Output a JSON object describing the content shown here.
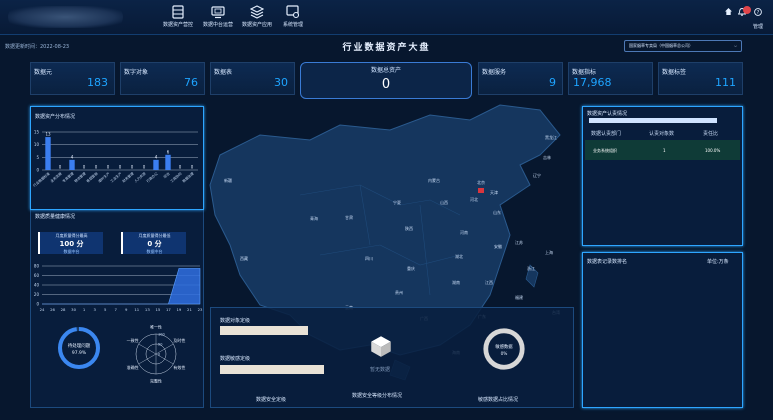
{
  "nav": {
    "items": [
      {
        "label": "数据资产营控",
        "icon": "database-icon"
      },
      {
        "label": "数据中台运营",
        "icon": "monitor-icon"
      },
      {
        "label": "数据资产应用",
        "icon": "layers-icon"
      },
      {
        "label": "系统管理",
        "icon": "settings-window-icon"
      }
    ],
    "user_label": "管理"
  },
  "header": {
    "update_time": "数据更新时间：2022-08-23",
    "title": "行业数据资产大盘",
    "org_select": "国家烟草专卖局（中国烟草总公司）"
  },
  "metrics": [
    {
      "label": "数据元",
      "value": "183"
    },
    {
      "label": "数字对象",
      "value": "76"
    },
    {
      "label": "数据表",
      "value": "30"
    },
    {
      "label": "数据服务",
      "value": "9"
    },
    {
      "label": "数据指标",
      "value": "17,968"
    },
    {
      "label": "数据标签",
      "value": "111"
    }
  ],
  "center_metric": {
    "label": "数据总资产",
    "value": "0"
  },
  "asset_distribution": {
    "title": "数据资产分布情况",
    "chart_data": {
      "type": "bar",
      "ylim": [
        0,
        15
      ],
      "yticks": [
        "0",
        "5",
        "10",
        "15"
      ],
      "categories": [
        "行业数据标准",
        "业务流程",
        "专卖管理",
        "物流管理",
        "卷烟营销",
        "烟叶生产",
        "工业生产",
        "财务管理",
        "人力资源",
        "行政办公",
        "综合",
        "工商协同",
        "数据治理"
      ],
      "values": [
        13,
        0,
        4,
        0,
        0,
        0,
        0,
        0,
        0,
        4,
        6,
        0,
        0
      ],
      "data_labels": [
        "13",
        "0",
        "4",
        "0",
        "0",
        "0",
        "0",
        "0",
        "0",
        "4",
        "6",
        "0",
        "0"
      ]
    }
  },
  "quality": {
    "title": "数据质量健康情况",
    "kpis": [
      {
        "label": "月度质量得分最高",
        "value": "100 分",
        "sub": "数据中台"
      },
      {
        "label": "月度质量得分最低",
        "value": "0 分",
        "sub": "数据中台"
      }
    ],
    "chart_data": {
      "type": "area",
      "yticks": [
        "0",
        "20",
        "40",
        "60",
        "80"
      ],
      "x": [
        "24",
        "26",
        "28",
        "30",
        "1",
        "3",
        "5",
        "7",
        "9",
        "11",
        "13",
        "15",
        "17",
        "19",
        "21",
        "23"
      ],
      "values": [
        0,
        0,
        0,
        0,
        0,
        0,
        0,
        0,
        0,
        0,
        0,
        0,
        0,
        75,
        75,
        75
      ]
    },
    "donut": {
      "label": "待处理问题",
      "value": "97.9%",
      "percent": 97.9
    },
    "radar": {
      "axes": [
        "唯一性",
        "及时性",
        "有效性",
        "完整性",
        "准确性",
        "一致性"
      ],
      "ticks": [
        "100",
        "50",
        "0"
      ]
    }
  },
  "security": {
    "bars": [
      {
        "label": "数据对象定级",
        "percent": 100
      },
      {
        "label": "数据敏感定级",
        "percent": 100
      }
    ],
    "section_label": "数据安全定级",
    "center_label": "数据安全等级分布情况",
    "empty_text": "暂无数据",
    "donut_label": "敏感数据",
    "donut_value": "0%",
    "right_label": "敏感数据占比情况"
  },
  "ownership": {
    "title": "数据资产认责情况",
    "columns": [
      "数据认责部门",
      "认责对象数",
      "责任比"
    ],
    "rows": [
      [
        "业务系统组织",
        "1",
        "100.0%"
      ]
    ]
  },
  "ranking": {
    "title": "数据表记录数排名",
    "unit": "单位:万条"
  },
  "map_labels": [
    {
      "name": "黑龙江"
    },
    {
      "name": "吉林"
    },
    {
      "name": "辽宁"
    },
    {
      "name": "内蒙古"
    },
    {
      "name": "北京"
    },
    {
      "name": "天津"
    },
    {
      "name": "河北"
    },
    {
      "name": "山西"
    },
    {
      "name": "宁夏"
    },
    {
      "name": "山东"
    },
    {
      "name": "陕西"
    },
    {
      "name": "河南"
    },
    {
      "name": "江苏"
    },
    {
      "name": "安徽"
    },
    {
      "name": "上海"
    },
    {
      "name": "湖北"
    },
    {
      "name": "浙江"
    },
    {
      "name": "四川"
    },
    {
      "name": "重庆"
    },
    {
      "name": "湖南"
    },
    {
      "name": "江西"
    },
    {
      "name": "福建"
    },
    {
      "name": "贵州"
    },
    {
      "name": "云南"
    },
    {
      "name": "广西"
    },
    {
      "name": "广东"
    },
    {
      "name": "海南"
    },
    {
      "name": "台湾"
    },
    {
      "name": "甘肃"
    },
    {
      "name": "青海"
    },
    {
      "name": "新疆"
    },
    {
      "name": "西藏"
    }
  ]
}
